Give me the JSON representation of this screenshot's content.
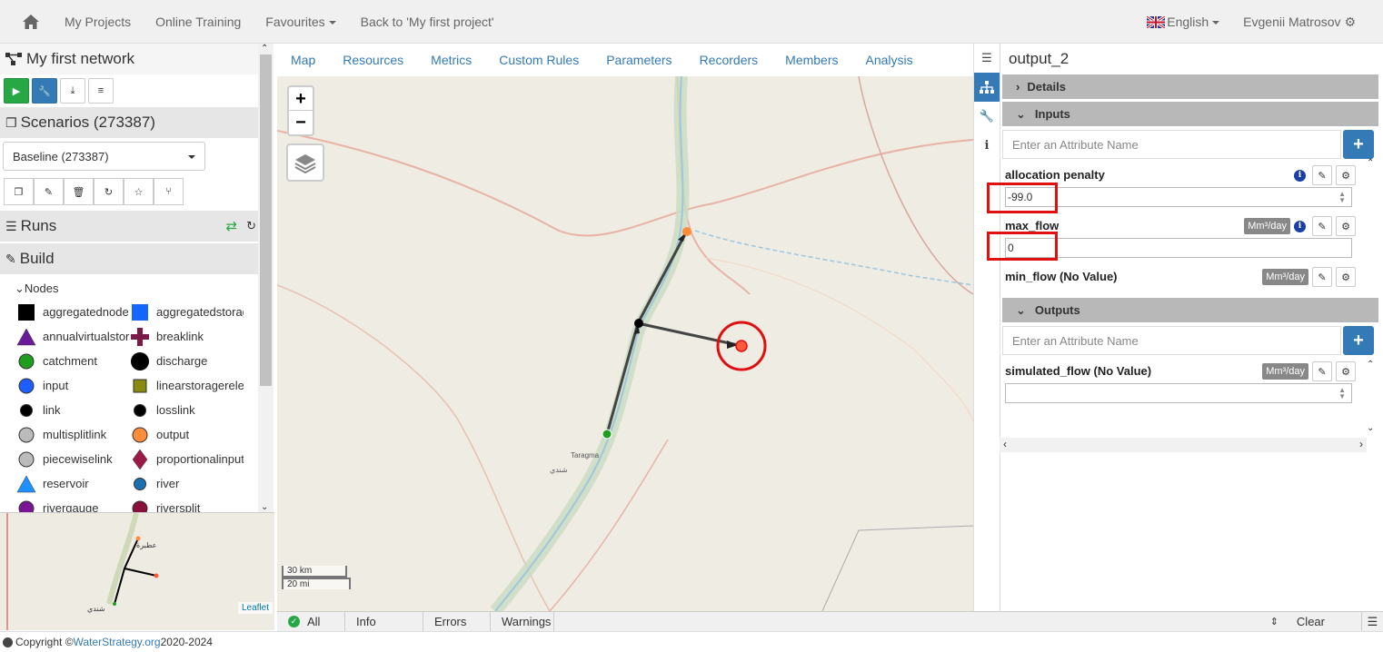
{
  "topnav": {
    "items": [
      "My Projects",
      "Online Training",
      "Favourites",
      "Back to 'My first project'"
    ],
    "language": "English",
    "user": "Evgenii Matrosov"
  },
  "network": {
    "title": "My first network",
    "scenarios_title": "Scenarios (273387)",
    "scenario_selected": "Baseline (273387)",
    "runs_title": "Runs",
    "build_title": "Build",
    "nodes_title": "Nodes",
    "nodes": [
      {
        "label": "aggregatednode",
        "shape": "square",
        "color": "#000000"
      },
      {
        "label": "aggregatedstorag",
        "shape": "square",
        "color": "#1565ff"
      },
      {
        "label": "annualvirtualstor",
        "shape": "triangle",
        "color": "#6a1b9a"
      },
      {
        "label": "breaklink",
        "shape": "cross",
        "color": "#7b1a48"
      },
      {
        "label": "catchment",
        "shape": "circle",
        "color": "#1e9e1e"
      },
      {
        "label": "discharge",
        "shape": "bigcircle",
        "color": "#000000"
      },
      {
        "label": "input",
        "shape": "circle",
        "color": "#1e5eff"
      },
      {
        "label": "linearstoragerele",
        "shape": "smallsquare",
        "color": "#8a8a10"
      },
      {
        "label": "link",
        "shape": "smallcircle",
        "color": "#000000"
      },
      {
        "label": "losslink",
        "shape": "smallcircle",
        "color": "#000000"
      },
      {
        "label": "multisplitlink",
        "shape": "circle",
        "color": "#bbbbbb"
      },
      {
        "label": "output",
        "shape": "circle",
        "color": "#ff8c3a"
      },
      {
        "label": "piecewiselink",
        "shape": "circle",
        "color": "#bbbbbb"
      },
      {
        "label": "proportionalinput",
        "shape": "diamond",
        "color": "#9a1b4a"
      },
      {
        "label": "reservoir",
        "shape": "triangle",
        "color": "#1e90ff"
      },
      {
        "label": "river",
        "shape": "smallcircle",
        "color": "#1a6fb0"
      },
      {
        "label": "rivergauge",
        "shape": "circle",
        "color": "#7b1596"
      },
      {
        "label": "riversplit",
        "shape": "circle",
        "color": "#8a0f3a"
      }
    ]
  },
  "map_tabs": [
    "Map",
    "Resources",
    "Metrics",
    "Custom Rules",
    "Parameters",
    "Recorders",
    "Members",
    "Analysis"
  ],
  "map": {
    "scale_km": "30 km",
    "scale_mi": "20 mi",
    "leaflet": "Leaflet",
    "place_labels": [
      "Taragma",
      "شندي"
    ]
  },
  "logbar": {
    "tabs": [
      "All",
      "Info",
      "Errors",
      "Warnings"
    ],
    "clear": "Clear"
  },
  "footer": {
    "prefix": "Copyright © ",
    "link": "WaterStrategy.org",
    "suffix": " 2020-2024"
  },
  "panel": {
    "title": "output_2",
    "details": "Details",
    "inputs": "Inputs",
    "outputs": "Outputs",
    "placeholder": "Enter an Attribute Name",
    "attrs": [
      {
        "name": "allocation penalty",
        "value": "-99.0",
        "unit": ""
      },
      {
        "name": "max_flow",
        "value": "0",
        "unit": "Mm³/day"
      },
      {
        "name": "min_flow (No Value)",
        "unit": "Mm³/day"
      }
    ],
    "out_attrs": [
      {
        "name": "simulated_flow (No Value)",
        "unit": "Mm³/day",
        "value": ""
      }
    ]
  },
  "colors": {
    "accent": "#337ab7",
    "highlight": "#e01010",
    "node_output": "#ff8c3a"
  }
}
